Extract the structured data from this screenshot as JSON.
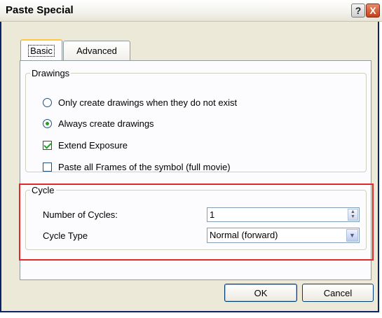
{
  "window": {
    "title": "Paste Special",
    "help_symbol": "?",
    "close_symbol": "X"
  },
  "tabs": [
    {
      "label": "Basic",
      "selected": true
    },
    {
      "label": "Advanced",
      "selected": false
    }
  ],
  "drawings": {
    "legend": "Drawings",
    "options": [
      {
        "label": "Only create drawings when they do not exist",
        "type": "radio",
        "checked": false
      },
      {
        "label": "Always create drawings",
        "type": "radio",
        "checked": true
      },
      {
        "label": "Extend Exposure",
        "type": "checkbox",
        "checked": true
      },
      {
        "label": "Paste all Frames of the symbol (full movie)",
        "type": "checkbox",
        "checked": false
      }
    ]
  },
  "cycle": {
    "legend": "Cycle",
    "number_label": "Number of Cycles:",
    "number_value": "1",
    "type_label": "Cycle Type",
    "type_value": "Normal (forward)"
  },
  "buttons": {
    "ok": "OK",
    "cancel": "Cancel"
  },
  "colors": {
    "highlight": "#e32626",
    "title_text": "#000000",
    "dialog_bg": "#ece9d8"
  }
}
